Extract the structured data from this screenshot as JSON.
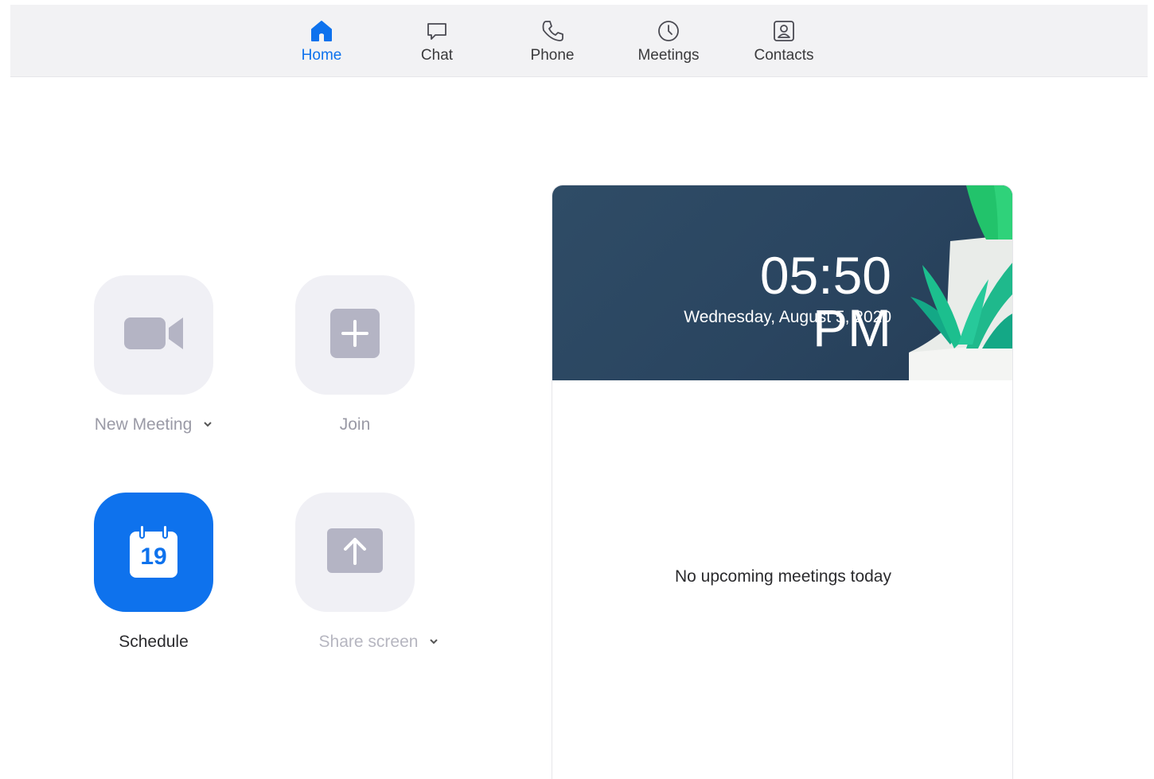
{
  "nav": {
    "tabs": [
      {
        "label": "Home",
        "icon": "home-icon",
        "active": true
      },
      {
        "label": "Chat",
        "icon": "chat-icon",
        "active": false
      },
      {
        "label": "Phone",
        "icon": "phone-icon",
        "active": false
      },
      {
        "label": "Meetings",
        "icon": "clock-icon",
        "active": false
      },
      {
        "label": "Contacts",
        "icon": "contacts-icon",
        "active": false
      }
    ]
  },
  "actions": {
    "new_meeting": {
      "label": "New Meeting",
      "icon": "video-camera-icon",
      "has_dropdown": true
    },
    "join": {
      "label": "Join",
      "icon": "plus-icon"
    },
    "schedule": {
      "label": "Schedule",
      "icon": "calendar-icon",
      "calendar_day": "19"
    },
    "share_screen": {
      "label": "Share screen",
      "icon": "upload-arrow-icon",
      "has_dropdown": true
    }
  },
  "clock_card": {
    "time": "05:50 PM",
    "date": "Wednesday, August 5, 2020",
    "empty_message": "No upcoming meetings today"
  },
  "colors": {
    "accent": "#0e72ed",
    "tile_bg": "#f0f0f5",
    "tile_icon": "#b4b4c4",
    "banner_bg": "#2c4762",
    "plant_green": "#16b07a"
  }
}
